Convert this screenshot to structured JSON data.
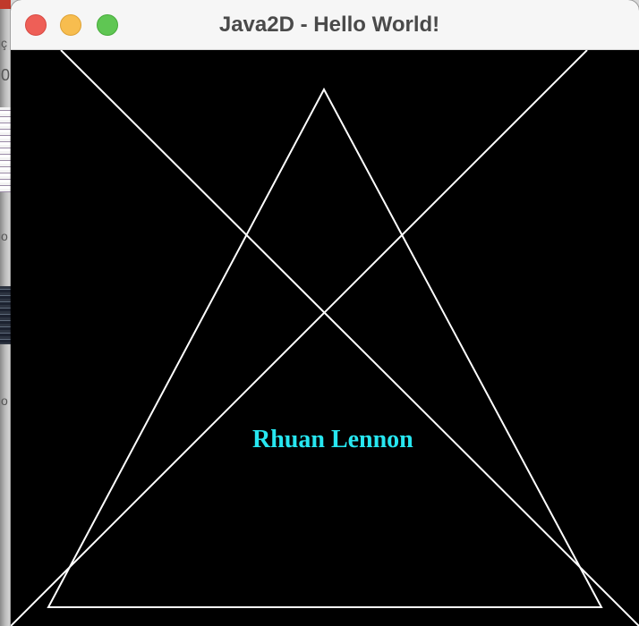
{
  "window": {
    "title": "Java2D - Hello World!"
  },
  "canvas": {
    "text": "Rhuan Lennon",
    "text_color": "#27e6f0",
    "line_color": "#ffffff",
    "background": "#000000"
  },
  "desktop_edge_glyphs": [
    "ç",
    "0",
    "o",
    "o"
  ]
}
